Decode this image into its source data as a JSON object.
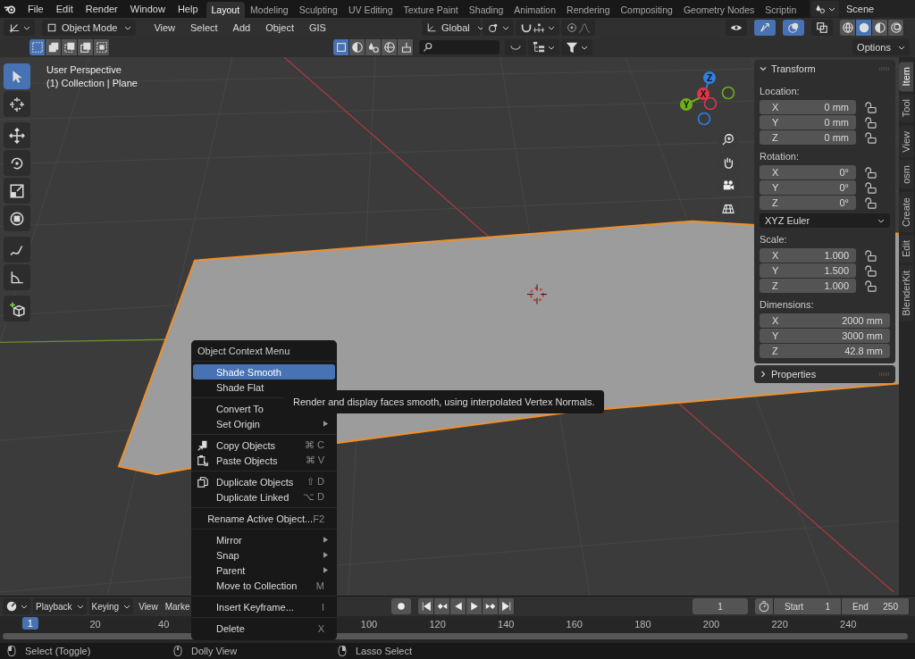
{
  "top_bar": {
    "menus": [
      "File",
      "Edit",
      "Render",
      "Window",
      "Help"
    ],
    "workspaces": [
      {
        "label": "Layout",
        "selected": true
      },
      {
        "label": "Modeling",
        "selected": false
      },
      {
        "label": "Sculpting",
        "selected": false
      },
      {
        "label": "UV Editing",
        "selected": false
      },
      {
        "label": "Texture Paint",
        "selected": false
      },
      {
        "label": "Shading",
        "selected": false
      },
      {
        "label": "Animation",
        "selected": false
      },
      {
        "label": "Rendering",
        "selected": false
      },
      {
        "label": "Compositing",
        "selected": false
      },
      {
        "label": "Geometry Nodes",
        "selected": false
      },
      {
        "label": "Scriptin",
        "selected": false
      }
    ],
    "scene": "Scene"
  },
  "header": {
    "mode": "Object Mode",
    "menus": [
      "View",
      "Select",
      "Add",
      "Object",
      "GIS"
    ],
    "orientation": "Global",
    "selection_modes": [
      {
        "kind": "new",
        "selected": true
      },
      {
        "kind": "extend",
        "selected": false
      },
      {
        "kind": "subtract",
        "selected": false
      },
      {
        "kind": "invert",
        "selected": false
      },
      {
        "kind": "intersect",
        "selected": false
      }
    ],
    "toggles": [
      {
        "kind": "visibility",
        "on": false
      },
      {
        "kind": "gizmo",
        "on": true
      },
      {
        "kind": "overlay",
        "on": true
      },
      {
        "kind": "xray",
        "on": false
      }
    ],
    "shading": [
      {
        "kind": "wireframe",
        "selected": false
      },
      {
        "kind": "solid",
        "selected": true
      },
      {
        "kind": "material",
        "selected": false
      },
      {
        "kind": "rendered",
        "selected": false
      }
    ],
    "object_types": [
      {
        "kind": "box",
        "selected": true
      },
      {
        "kind": "halfdisc",
        "selected": false
      },
      {
        "kind": "drops",
        "selected": false
      },
      {
        "kind": "globe",
        "selected": false
      },
      {
        "kind": "brush",
        "selected": false
      }
    ],
    "options": "Options"
  },
  "viewport": {
    "view": "User Perspective",
    "collection": "(1) Collection | Plane",
    "gizmo": [
      {
        "label": "Z",
        "color": "#2f7fe0"
      },
      {
        "label": "Y",
        "color": "#6fae1b"
      },
      {
        "label": "X",
        "color": "#e0344a"
      }
    ],
    "tool_groups": [
      [
        {
          "kind": "select",
          "selected": true
        },
        {
          "kind": "cursor",
          "selected": false
        }
      ],
      [
        {
          "kind": "move",
          "selected": false
        },
        {
          "kind": "rotate",
          "selected": false
        },
        {
          "kind": "scale",
          "selected": false
        },
        {
          "kind": "transform",
          "selected": false
        }
      ],
      [
        {
          "kind": "annotate",
          "selected": false
        },
        {
          "kind": "measure",
          "selected": false
        }
      ],
      [
        {
          "kind": "addcube",
          "selected": false
        }
      ]
    ]
  },
  "sidebar": {
    "tabs": [
      {
        "label": "Item",
        "selected": true
      },
      {
        "label": "Tool",
        "selected": false
      },
      {
        "label": "View",
        "selected": false
      },
      {
        "label": "osm",
        "selected": false
      },
      {
        "label": "Create",
        "selected": false
      },
      {
        "label": "Edit",
        "selected": false
      },
      {
        "label": "BlenderKit",
        "selected": false
      }
    ],
    "transform": {
      "title": "Transform",
      "expanded": true,
      "sections": [
        {
          "label": "Location:",
          "fields": [
            {
              "axis": "X",
              "value": "0 mm",
              "locked": false
            },
            {
              "axis": "Y",
              "value": "0 mm",
              "locked": false
            },
            {
              "axis": "Z",
              "value": "0 mm",
              "locked": false
            }
          ]
        },
        {
          "label": "Rotation:",
          "fields": [
            {
              "axis": "X",
              "value": "0°",
              "locked": false
            },
            {
              "axis": "Y",
              "value": "0°",
              "locked": false
            },
            {
              "axis": "Z",
              "value": "0°",
              "locked": false
            }
          ],
          "mode": "XYZ Euler"
        },
        {
          "label": "Scale:",
          "fields": [
            {
              "axis": "X",
              "value": "1.000",
              "locked": false
            },
            {
              "axis": "Y",
              "value": "1.500",
              "locked": false
            },
            {
              "axis": "Z",
              "value": "1.000",
              "locked": false
            }
          ]
        },
        {
          "label": "Dimensions:",
          "fields": [
            {
              "axis": "X",
              "value": "2000 mm"
            },
            {
              "axis": "Y",
              "value": "3000 mm"
            },
            {
              "axis": "Z",
              "value": "42.8 mm"
            }
          ]
        }
      ]
    },
    "properties": {
      "title": "Properties",
      "expanded": false
    }
  },
  "context_menu": {
    "title": "Object Context Menu",
    "groups": [
      [
        {
          "label": "Shade Smooth",
          "selected": true,
          "submenu": false
        },
        {
          "label": "Shade Flat",
          "selected": false,
          "submenu": false
        }
      ],
      [
        {
          "label": "Convert To",
          "selected": false,
          "submenu": false
        },
        {
          "label": "Set Origin",
          "selected": false,
          "submenu": true
        }
      ],
      [
        {
          "label": "Copy Objects",
          "kind": "copy",
          "shortcut": "⌘ C",
          "selected": false,
          "submenu": false
        },
        {
          "label": "Paste Objects",
          "kind": "paste",
          "shortcut": "⌘ V",
          "selected": false,
          "submenu": false
        }
      ],
      [
        {
          "label": "Duplicate Objects",
          "kind": "duplicate",
          "shortcut": "⇧ D",
          "selected": false,
          "submenu": false
        },
        {
          "label": "Duplicate Linked",
          "shortcut": "⌥ D",
          "selected": false,
          "submenu": false
        }
      ],
      [
        {
          "label": "Rename Active Object...",
          "shortcut": "F2",
          "selected": false,
          "submenu": false
        }
      ],
      [
        {
          "label": "Mirror",
          "selected": false,
          "submenu": true
        },
        {
          "label": "Snap",
          "selected": false,
          "submenu": true
        },
        {
          "label": "Parent",
          "selected": false,
          "submenu": true
        },
        {
          "label": "Move to Collection",
          "shortcut": "M",
          "selected": false,
          "submenu": false
        }
      ],
      [
        {
          "label": "Insert Keyframe...",
          "shortcut": "I",
          "selected": false,
          "submenu": false
        }
      ],
      [
        {
          "label": "Delete",
          "shortcut": "X",
          "selected": false,
          "submenu": false
        }
      ]
    ]
  },
  "tooltip": "Render and display faces smooth, using interpolated Vertex Normals.",
  "timeline": {
    "menus": [
      {
        "label": "Playback",
        "dropdown": true
      },
      {
        "label": "Keying",
        "dropdown": true
      },
      {
        "label": "View",
        "dropdown": false
      },
      {
        "label": "Marke",
        "dropdown": false
      }
    ],
    "current_frame": "1",
    "start_label": "Start",
    "start": "1",
    "end_label": "End",
    "end": "250",
    "playhead": "1",
    "ruler": [
      "20",
      "40",
      "100",
      "120",
      "140",
      "160",
      "180",
      "200",
      "220",
      "240"
    ]
  },
  "status_bar": [
    {
      "kind": "left",
      "label": "Select (Toggle)"
    },
    {
      "kind": "middle",
      "label": "Dolly View"
    },
    {
      "kind": "right",
      "label": "Lasso Select"
    }
  ]
}
